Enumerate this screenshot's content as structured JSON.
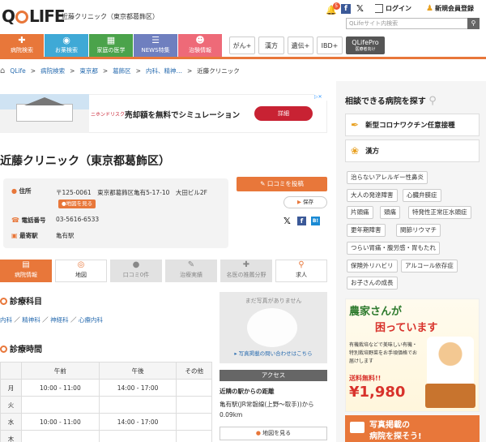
{
  "header": {
    "logo": "QLIFE",
    "site_name": "近藤クリニック（東京都葛飾区）",
    "notification_count": "5",
    "login": "ログイン",
    "register": "新規会員登録",
    "search_placeholder": "QLifeサイト内検索"
  },
  "nav": {
    "main": [
      {
        "label": "病院検索",
        "color": "#e8773a",
        "icon": "hospital-icon"
      },
      {
        "label": "お薬検索",
        "color": "#3fa9d6",
        "icon": "pill-icon"
      },
      {
        "label": "家庭の医学",
        "color": "#4ba34b",
        "icon": "medkit-icon"
      },
      {
        "label": "NEWS特集",
        "color": "#6f7fbf",
        "icon": "news-icon"
      },
      {
        "label": "治験情報",
        "color": "#ee6a78",
        "icon": "people-icon"
      }
    ],
    "secondary": [
      {
        "label": "がん+"
      },
      {
        "label": "漢方"
      },
      {
        "label": "遺伝+"
      },
      {
        "label": "IBD+"
      },
      {
        "label": "QLifePro",
        "sub": "医療者向け",
        "color": "#555555"
      }
    ]
  },
  "breadcrumb": [
    "QLife",
    "病院検索",
    "東京都",
    "葛飾区",
    "内科、精神…",
    "近藤クリニック"
  ],
  "ad_banner": {
    "brand": "ニホンドリスク",
    "text": "売却額を無料でシミュレーション",
    "button": "詳細"
  },
  "clinic": {
    "title": "近藤クリニック（東京都葛飾区）",
    "address_label": "住所",
    "postal": "〒125-0061",
    "address": "東京都葛飾区亀有5-17-10　大田ビル2F",
    "map_button": "地図を見る",
    "phone_label": "電話番号",
    "phone": "03-5616-6533",
    "station_label": "最寄駅",
    "station": "亀有駅",
    "review_button": "口コミを投稿",
    "save_button": "保存"
  },
  "tabs": [
    {
      "label": "病院情報",
      "state": "active",
      "icon": "document-icon"
    },
    {
      "label": "地図",
      "state": "normal",
      "icon": "pin-icon"
    },
    {
      "label": "口コミ0件",
      "state": "disabled",
      "icon": "chat-icon"
    },
    {
      "label": "治療実績",
      "state": "disabled",
      "icon": "pen-icon"
    },
    {
      "label": "名医の推薦分野",
      "state": "disabled",
      "icon": "cross-icon"
    },
    {
      "label": "求人",
      "state": "normal",
      "icon": "search-person-icon"
    }
  ],
  "departments": {
    "heading": "診療科目",
    "items": [
      "内科",
      "精神科",
      "神経科",
      "心療内科"
    ]
  },
  "hours": {
    "heading": "診療時間",
    "columns": [
      "",
      "午前",
      "午後",
      "その他"
    ],
    "rows": [
      [
        "月",
        "10:00 - 11:00",
        "14:00 - 17:00",
        ""
      ],
      [
        "火",
        "",
        "",
        ""
      ],
      [
        "水",
        "10:00 - 11:00",
        "14:00 - 17:00",
        ""
      ],
      [
        "木",
        "",
        "",
        ""
      ]
    ]
  },
  "photo": {
    "placeholder": "まだ写真がありません",
    "inquiry": "写真掲載の問い合わせはこちら"
  },
  "access": {
    "heading": "アクセス",
    "subheading": "近隣の駅からの距離",
    "text": "亀有駅(JR常磐線(上野～取手))から0.09km",
    "map_button": "地図を見る"
  },
  "sidebar": {
    "title": "相談できる病院を探す",
    "cards": [
      {
        "label": "新型コロナワクチン任意接種",
        "icon": "syringe-icon"
      },
      {
        "label": "漢方",
        "icon": "herb-icon"
      }
    ],
    "tags": [
      [
        "治らないアレルギー性鼻炎"
      ],
      [
        "大人の発達障害",
        "心臓弁膜症"
      ],
      [
        "片頭痛",
        "頭痛",
        "特発性正常圧水頭症"
      ],
      [
        "更年期障害",
        "関節リウマチ"
      ],
      [
        "つらい胃痛・腹労感・胃もたれ"
      ],
      [
        "保険外リハビリ",
        "アルコール依存症"
      ],
      [
        "お子さんの成長"
      ]
    ],
    "ad2": {
      "headline1": "農家さんが",
      "headline2": "困っています",
      "body": "有機栽培などで美味しい有機・特別栽培野菜をお手頃価格でお届けします",
      "shipping": "送料無料!!",
      "price": "¥1,980"
    },
    "ad3": {
      "line1": "写真掲載の",
      "line2": "病院を探そう!"
    }
  }
}
